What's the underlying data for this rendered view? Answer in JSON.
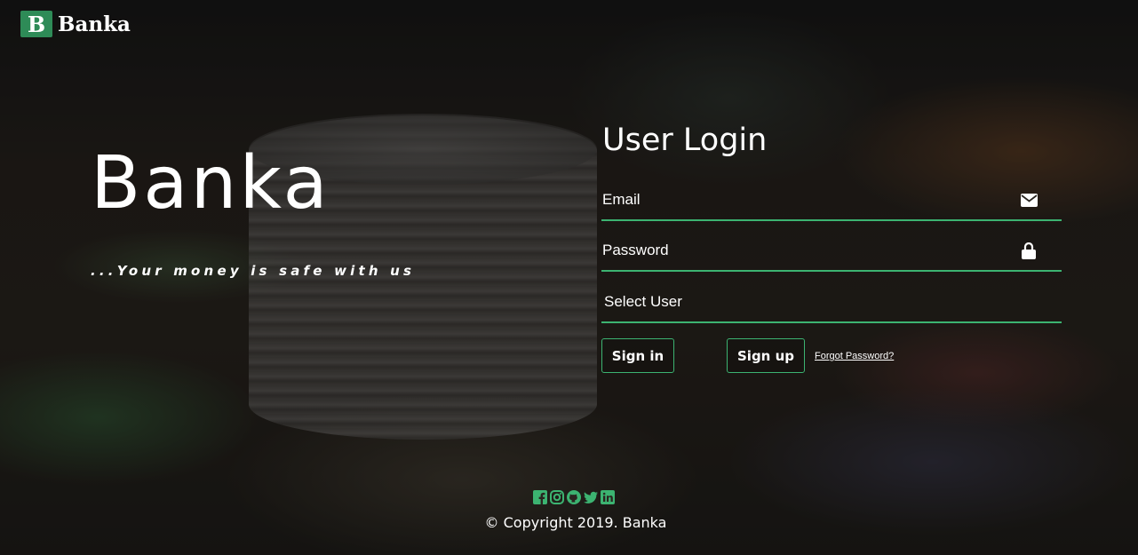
{
  "brand": {
    "logo_letter": "B",
    "logo_text": "Banka",
    "accent_color": "#3cb371"
  },
  "hero": {
    "title": "Banka",
    "tagline": "...Your money is safe with us"
  },
  "login": {
    "title": "User Login",
    "email_label": "Email",
    "email_icon": "envelope-icon",
    "password_label": "Password",
    "password_icon": "lock-icon",
    "select_label": "Select User",
    "signin_label": "Sign in",
    "signup_label": "Sign up",
    "forgot_label": "Forgot Password?"
  },
  "footer": {
    "social_icons": [
      "facebook-icon",
      "instagram-icon",
      "github-icon",
      "twitter-icon",
      "linkedin-icon"
    ],
    "copyright": "© Copyright 2019. Banka"
  }
}
